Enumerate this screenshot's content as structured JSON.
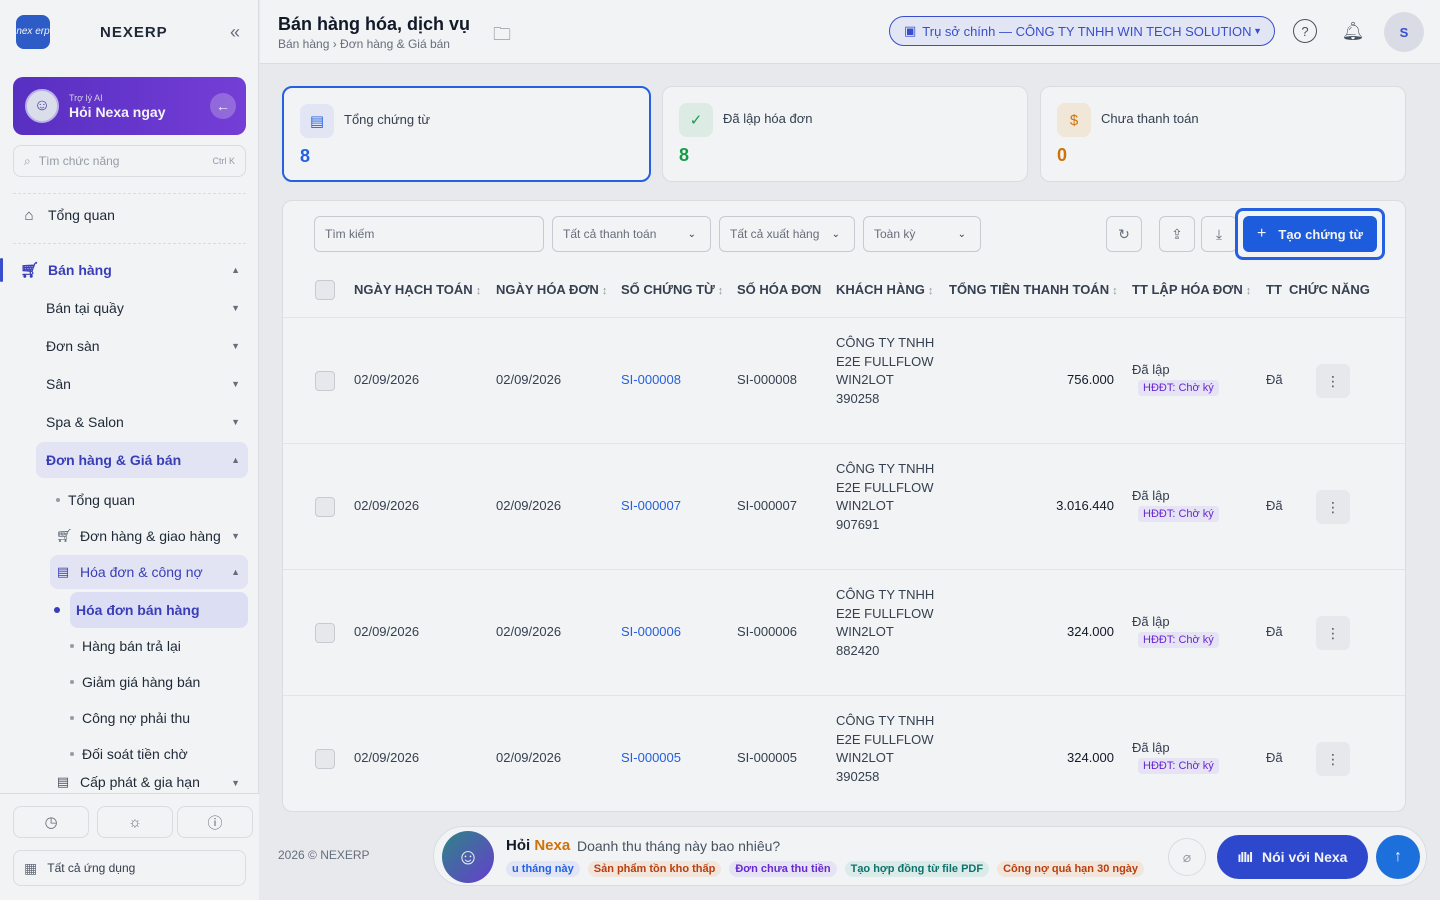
{
  "sidebar": {
    "logo_text": "nex erp",
    "brand": "NEXERP",
    "collapse_icon": "«",
    "ai": {
      "small": "Trợ lý AI",
      "big": "Hỏi Nexa ngay"
    },
    "search": {
      "placeholder": "Tìm chức năng",
      "shortcut": "Ctrl K"
    },
    "overview": "Tổng quan",
    "sales": "Bán hàng",
    "items": [
      {
        "label": "Bán tại quầy"
      },
      {
        "label": "Đơn sàn"
      },
      {
        "label": "Sân"
      },
      {
        "label": "Spa & Salon"
      },
      {
        "label": "Đơn hàng & Giá bán"
      }
    ],
    "sub": {
      "overview": "Tổng quan",
      "orders_delivery": "Đơn hàng & giao hàng",
      "invoice_debt": "Hóa đơn & công nợ",
      "leaves": [
        {
          "label": "Hóa đơn bán hàng"
        },
        {
          "label": "Hàng bán trả lại"
        },
        {
          "label": "Giảm giá hàng bán"
        },
        {
          "label": "Công nợ phải thu"
        },
        {
          "label": "Đối soát tiền chờ"
        }
      ],
      "cut_off": "Cấp phát & gia hạn"
    },
    "all_apps": "Tất cả ứng dụng"
  },
  "header": {
    "title": "Bán hàng hóa, dịch vụ",
    "breadcrumb": "Bán hàng › Đơn hàng & Giá bán",
    "company": "Trụ sở chính — CÔNG TY TNHH WIN TECH SOLUTION",
    "avatar_initial": "S"
  },
  "stats": [
    {
      "label": "Tổng chứng từ",
      "value": "8",
      "color": "#2563eb"
    },
    {
      "label": "Đã lập hóa đơn",
      "value": "8",
      "color": "#16a34a"
    },
    {
      "label": "Chưa thanh toán",
      "value": "0",
      "color": "#d97706"
    }
  ],
  "toolbar": {
    "search_placeholder": "Tìm kiếm",
    "payment_filter": "Tất cả thanh toán",
    "export_filter": "Tất cả xuất hàng",
    "period_filter": "Toàn kỳ",
    "create_label": "Tạo chứng từ"
  },
  "table": {
    "headers": [
      "NGÀY HẠCH TOÁN",
      "NGÀY HÓA ĐƠN",
      "SỐ CHỨNG TỪ",
      "SỐ HÓA ĐƠN",
      "KHÁCH HÀNG",
      "TỔNG TIỀN THANH TOÁN",
      "TT LẬP HÓA ĐƠN",
      "TT",
      "CHỨC NĂNG"
    ],
    "rows": [
      {
        "post_date": "02/09/2026",
        "invoice_date": "02/09/2026",
        "doc_no": "SI-000008",
        "invoice_no": "SI-000008",
        "customer": "CÔNG TY TNHH E2E FULLFLOW WIN2LOT 390258",
        "total": "756.000",
        "status": "Đã lập",
        "einvoice": "HĐĐT: Chờ ký",
        "tt": "Đã"
      },
      {
        "post_date": "02/09/2026",
        "invoice_date": "02/09/2026",
        "doc_no": "SI-000007",
        "invoice_no": "SI-000007",
        "customer": "CÔNG TY TNHH E2E FULLFLOW WIN2LOT 907691",
        "total": "3.016.440",
        "status": "Đã lập",
        "einvoice": "HĐĐT: Chờ ký",
        "tt": "Đã"
      },
      {
        "post_date": "02/09/2026",
        "invoice_date": "02/09/2026",
        "doc_no": "SI-000006",
        "invoice_no": "SI-000006",
        "customer": "CÔNG TY TNHH E2E FULLFLOW WIN2LOT 882420",
        "total": "324.000",
        "status": "Đã lập",
        "einvoice": "HĐĐT: Chờ ký",
        "tt": "Đã"
      },
      {
        "post_date": "02/09/2026",
        "invoice_date": "02/09/2026",
        "doc_no": "SI-000005",
        "invoice_no": "SI-000005",
        "customer": "CÔNG TY TNHH E2E FULLFLOW WIN2LOT 390258",
        "total": "324.000",
        "status": "Đã lập",
        "einvoice": "HĐĐT: Chờ ký",
        "tt": "Đã"
      }
    ]
  },
  "footer": {
    "copyright": "2026 © NEXERP"
  },
  "ask": {
    "label_prefix": "Hỏi ",
    "label_brand": "Nexa",
    "question": "Doanh thu tháng này bao nhiêu?",
    "chips": [
      {
        "label": "u tháng này",
        "color": "#2563eb",
        "bg": "#eef2ff"
      },
      {
        "label": "Sản phẩm tồn kho thấp",
        "color": "#c2410c",
        "bg": "#fff1e6"
      },
      {
        "label": "Đơn chưa thu tiền",
        "color": "#6d28d9",
        "bg": "#f3efff"
      },
      {
        "label": "Tạo hợp đồng từ file PDF",
        "color": "#0f766e",
        "bg": "#e6f7f4"
      },
      {
        "label": "Công nợ quá hạn 30 ngày",
        "color": "#c2410c",
        "bg": "#fff1e6"
      }
    ],
    "voice_label": "Nói với Nexa"
  }
}
